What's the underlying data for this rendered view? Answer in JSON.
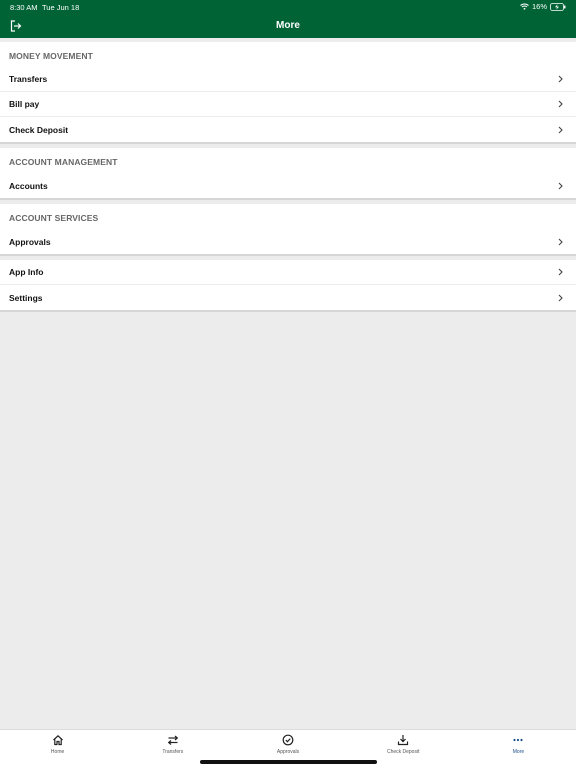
{
  "status": {
    "time": "8:30 AM",
    "date": "Tue Jun 18",
    "battery": "16%"
  },
  "header": {
    "title": "More",
    "color": "#006336"
  },
  "groups": [
    {
      "title": "MONEY MOVEMENT",
      "items": [
        {
          "label": "Transfers"
        },
        {
          "label": "Bill pay"
        },
        {
          "label": "Check Deposit"
        }
      ]
    },
    {
      "title": "ACCOUNT MANAGEMENT",
      "items": [
        {
          "label": "Accounts"
        }
      ]
    },
    {
      "title": "ACCOUNT SERVICES",
      "items": [
        {
          "label": "Approvals"
        }
      ]
    },
    {
      "title": "",
      "items": [
        {
          "label": "App Info"
        },
        {
          "label": "Settings"
        }
      ]
    }
  ],
  "tabs": [
    {
      "label": "Home",
      "icon": "home-icon"
    },
    {
      "label": "Transfers",
      "icon": "transfer-arrows-icon"
    },
    {
      "label": "Approvals",
      "icon": "check-circle-icon"
    },
    {
      "label": "Check Deposit",
      "icon": "download-tray-icon"
    },
    {
      "label": "More",
      "icon": "more-dots-icon",
      "active": true
    }
  ],
  "colors": {
    "accent": "#006336",
    "active_tab": "#1a4f8b"
  }
}
